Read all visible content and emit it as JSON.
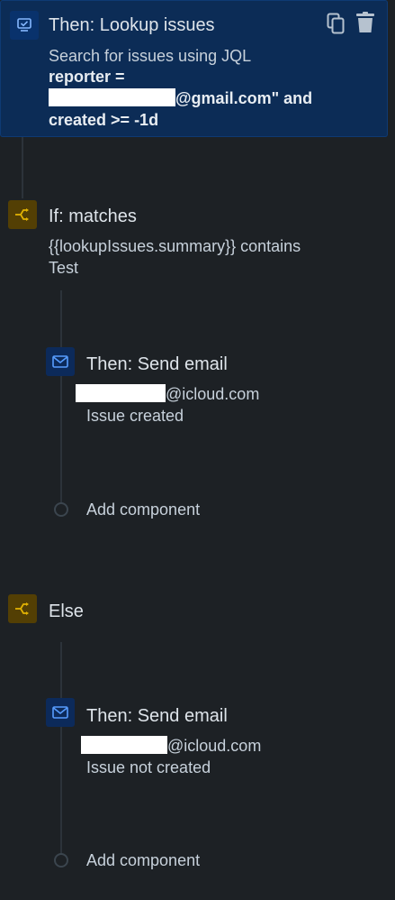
{
  "colors": {
    "background": "#1d2125",
    "selected_card": "#0c2c56",
    "action_icon_bg": "#0c2a5a",
    "condition_icon_bg": "#533f04",
    "condition_icon_fg": "#e2b203",
    "action_icon_fg": "#579dff"
  },
  "lookup": {
    "title": "Then: Lookup issues",
    "line1": "Search for issues using JQL",
    "line2": "reporter =",
    "line3_suffix": "@gmail.com\" and",
    "line4": "created >= -1d",
    "icon": "screen-check-icon",
    "copy_icon": "copy-icon",
    "delete_icon": "trash-icon"
  },
  "if_block": {
    "title": "If: matches",
    "line1": "{{lookupIssues.summary}} contains",
    "line2": "Test",
    "icon": "branch-icon"
  },
  "email1": {
    "title": "Then: Send email",
    "to_suffix": "@icloud.com",
    "subject": "Issue created",
    "icon": "mail-icon"
  },
  "add_component_1": "Add component",
  "else_block": {
    "title": "Else",
    "icon": "branch-icon"
  },
  "email2": {
    "title": "Then: Send email",
    "to_suffix": "@icloud.com",
    "subject": "Issue not created",
    "icon": "mail-icon"
  },
  "add_component_2": "Add component"
}
